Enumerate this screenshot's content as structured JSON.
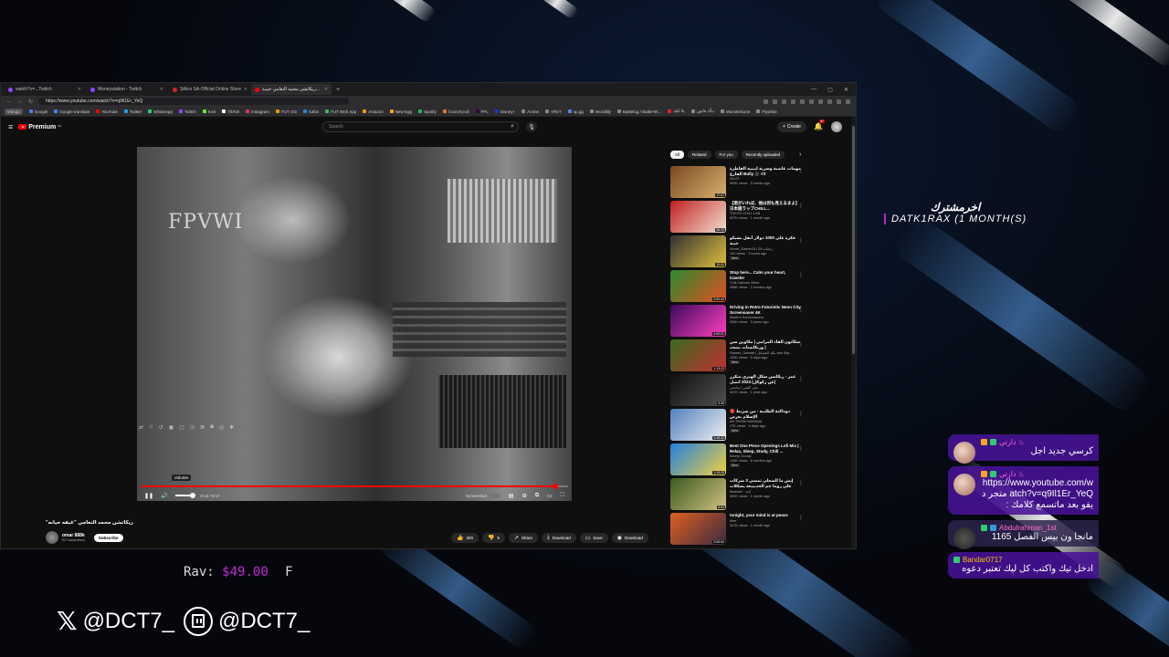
{
  "browser": {
    "tabs": [
      {
        "label": "watch?v=...Twitch",
        "color": "#9146ff"
      },
      {
        "label": "Moneystation - Twitch",
        "color": "#9146ff"
      },
      {
        "label": "Silkco SA Official Online Store",
        "color": "#e02020"
      },
      {
        "label": "ريكاتشن محمد التعامي حبيبة...",
        "color": "#ff0000"
      }
    ],
    "new_tab": "+",
    "window_controls": [
      "—",
      "▢",
      "✕"
    ],
    "url": "https://www.youtube.com/watch?v=q9Il1Er_YeQ",
    "bookmarks": [
      {
        "label": "Manga",
        "color": "#888"
      },
      {
        "label": "Google",
        "color": "#4285f4"
      },
      {
        "label": "Google translate",
        "color": "#4285f4"
      },
      {
        "label": "YouTube",
        "color": "#ff0000"
      },
      {
        "label": "Twitter",
        "color": "#1da1f2"
      },
      {
        "label": "WhatsApp",
        "color": "#25d366"
      },
      {
        "label": "Twitch",
        "color": "#9146ff"
      },
      {
        "label": "Kick",
        "color": "#53fc18"
      },
      {
        "label": "TikTok",
        "color": "#fff"
      },
      {
        "label": "Instagram",
        "color": "#e1306c"
      },
      {
        "label": "FUT GG",
        "color": "#e0a000"
      },
      {
        "label": "futbin",
        "color": "#1e88e5"
      },
      {
        "label": "FUT Web App",
        "color": "#3cba54"
      },
      {
        "label": "Amazon",
        "color": "#ff9900"
      },
      {
        "label": "New Egg",
        "color": "#f7a823"
      },
      {
        "label": "Spotify",
        "color": "#1db954"
      },
      {
        "label": "Crunchyroll",
        "color": "#f47521"
      },
      {
        "label": "FPL",
        "color": "#37003c"
      },
      {
        "label": "Disney+",
        "color": "#113ccf"
      },
      {
        "label": "Anime",
        "color": "#888"
      },
      {
        "label": "YRV7",
        "color": "#888"
      },
      {
        "label": "op.gg",
        "color": "#5383e8"
      },
      {
        "label": "Wordlilly",
        "color": "#888"
      },
      {
        "label": "Battlelog / BattleTel...",
        "color": "#888"
      },
      {
        "label": "يلا كيك",
        "color": "#e02020"
      },
      {
        "label": "نبأك قانون",
        "color": "#888"
      },
      {
        "label": "Monsterbone",
        "color": "#888"
      },
      {
        "label": "Flywhite",
        "color": "#888"
      }
    ]
  },
  "youtube": {
    "logo_text": "Premium",
    "logo_cc": "SA",
    "search_placeholder": "Search",
    "create_label": "Create",
    "notification_count": "9+",
    "player": {
      "overlay_text": "FPVWI",
      "tooltip": "Volume",
      "time": "8:15 / 8:17",
      "progress": 0.97,
      "screenshot_label": "Screenshot"
    },
    "video_title": "\"ريكاتشن محمد التعامي \"غيفه خيانه",
    "channel_name": "omar 888k",
    "channel_subs": "517 subscribers",
    "subscribe_label": "Subscribe",
    "actions": [
      {
        "icon": "👍",
        "label": "320",
        "name": "like-button"
      },
      {
        "icon": "👎",
        "label": "5",
        "name": "dislike-button"
      },
      {
        "icon": "↗",
        "label": "Share",
        "name": "share-button"
      },
      {
        "icon": "⤓",
        "label": "Download",
        "name": "download-button"
      },
      {
        "icon": "▭",
        "label": "Save",
        "name": "save-button"
      },
      {
        "icon": "◉",
        "label": "Download",
        "name": "extension-download-button"
      }
    ],
    "chips": [
      "All",
      "Related",
      "For you",
      "Recently uploaded"
    ],
    "related": [
      {
        "title": "مهمات عاشبة وسرية لبيبية القاطرة الفارع Bully 🎥 #3",
        "channel": "NILZ3",
        "views": "553K views · 3 weeks ago",
        "duration": "17:07",
        "color1": "#7a4a20",
        "color2": "#d8b070",
        "new": false
      },
      {
        "title": "【君がいれば、他は何も見えるまよ】日本語ラップCHILL...",
        "channel": "TOKYO CHILL LAB",
        "views": "637K views · 1 month ago",
        "duration": "58:33",
        "color1": "#c02020",
        "color2": "#f0e0d0",
        "new": false
      },
      {
        "title": "فكرة على 1000 دولار أنقل بسيكو حيبة",
        "channel": "Smart_Gamer25 | 25 رحمات",
        "views": "192 views · 3 hours ago",
        "duration": "10:01",
        "color1": "#303030",
        "color2": "#e0c040",
        "new": true
      },
      {
        "title": "Stop here... Calm your heart, traveler",
        "channel": "Chill Cartoon Vibes",
        "views": "356K views · 2 months ago",
        "duration": "3:00:44",
        "color1": "#2a8a30",
        "color2": "#e05020",
        "new": false
      },
      {
        "title": "Driving in Retro Futuristic Neon City Screensaver 4K",
        "channel": "Modern Screensavers",
        "views": "926K views · 3 years ago",
        "duration": "4:00:01",
        "color1": "#3a0a5a",
        "color2": "#ff40c0",
        "new": false
      },
      {
        "title": "سكاتون القاد المرامي | مكاوين سن | ورنكاشنات بضحد",
        "channel": "Hamed_Gotelail | بكلد الفسانل and Styl...",
        "views": "159K views · 5 days ago",
        "duration": "1:13:22",
        "color1": "#3a6a20",
        "color2": "#c03030",
        "new": true
      },
      {
        "title": "عمر - ريكاشن سكل الهيري متكرر (عن ركوكل) 2024 اتصل",
        "channel": "عمر الشير | سامعي",
        "views": "447K views · 1 year ago",
        "duration": "5:39",
        "color1": "#101010",
        "color2": "#505050",
        "new": false
      },
      {
        "title": "🔴 دوداكنة الطلبية - من شريط الإسلام بعرض",
        "channel": "AH SHOW NAKAMA",
        "views": "27K views · 4 days ago",
        "duration": "4:45:31",
        "color1": "#5080c0",
        "color2": "#f0f0f0",
        "new": true
      },
      {
        "title": "Best One Piece Openings Lofi Mix | Relax, Sleep, Study, Chill ...",
        "channel": "Barely Cloudy",
        "views": "140K views · 6 months ago",
        "duration": "1:19:25",
        "color1": "#2080e0",
        "color2": "#f0d040",
        "new": true
      },
      {
        "title": "إيش ما الشعلي تمشي 3 شركات على روما جم الحديبيعة بشكلات",
        "channel": "Batsmer · اثنه",
        "views": "302K views · 1 month ago",
        "duration": "8:54",
        "color1": "#3a5a20",
        "color2": "#d0c080",
        "new": false
      },
      {
        "title": "tonight, your mind is at peace",
        "channel": "tiber",
        "views": "347K views · 1 month ago",
        "duration": "3:08:50",
        "color1": "#e06020",
        "color2": "#3a2a40",
        "new": false
      }
    ]
  },
  "overlay": {
    "sub_alert_name": "اخرمشترك",
    "sub_alert_detail": "DATK1RAX (1 MONTH(S)",
    "rav_label": "Rav:",
    "rav_amount": "$49.00",
    "rav_suffix": "F",
    "x_handle": "@DCT7_",
    "twitch_handle": "@DCT7_",
    "chat": [
      {
        "user": "دارتي ♨",
        "text": "كرسي جديد اجل",
        "style": "purple",
        "badge1": "#f5a623",
        "badge2": "#2ecc71"
      },
      {
        "user": "دارتي ♨",
        "text": "https://www.youtube.com/watch?v=q9Il1Er_YeQ متجر ديفو بعد ماتسمع كلامك :",
        "style": "purple",
        "badge1": "#f5a623",
        "badge2": "#2ecc71"
      },
      {
        "user": "Abdulrahman_1st",
        "text": "مانجا ون بيس الفصل 1165",
        "style": "grey",
        "badge1": "#2ecc71",
        "badge2": "#3498db"
      },
      {
        "user": "Bandar0717",
        "text": "ادخل تيك واكتب كل ليك تعتبر دعوه",
        "style": "plain",
        "badge1": "#2ecc71",
        "badge2": ""
      }
    ],
    "colors": {
      "accent": "#c02bd8",
      "chat_bg": "#48129a"
    }
  }
}
